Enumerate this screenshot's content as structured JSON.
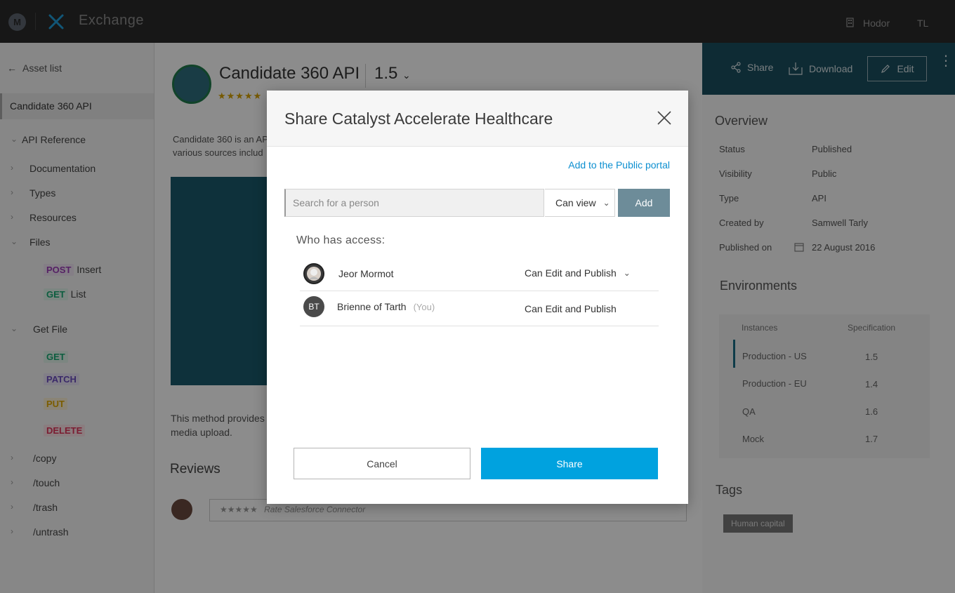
{
  "topbar": {
    "app_title": "Exchange",
    "org_name": "Hodor",
    "user_initials": "TL"
  },
  "sidebar": {
    "back_label": "Asset list",
    "current_asset": "Candidate 360 API",
    "api_reference": "API Reference",
    "items": [
      {
        "label": "Documentation"
      },
      {
        "label": "Types"
      },
      {
        "label": "Resources"
      },
      {
        "label": "Files"
      }
    ],
    "files_methods": [
      {
        "method": "POST",
        "label": "Insert"
      },
      {
        "method": "GET",
        "label": "List"
      }
    ],
    "get_file": "Get File",
    "get_file_methods": [
      "GET",
      "PATCH",
      "PUT",
      "DELETE"
    ],
    "resources": [
      "/copy",
      "/touch",
      "/trash",
      "/untrash"
    ]
  },
  "main": {
    "asset_title": "Candidate 360 API",
    "version": "1.5",
    "stars": "★★★★★",
    "desc_line1": "Candidate 360 is an AP",
    "desc_line2": "various sources includ",
    "method_desc_line1": "This method provides",
    "method_desc_line2": "media upload.",
    "reviews_title": "Reviews",
    "review_stars": "★★★★★",
    "review_placeholder": "Rate Salesforce Connector"
  },
  "rightpanel": {
    "share_label": "Share",
    "download_label": "Download",
    "edit_label": "Edit",
    "overview_title": "Overview",
    "overview": [
      {
        "label": "Status",
        "value": "Published"
      },
      {
        "label": "Visibility",
        "value": "Public"
      },
      {
        "label": "Type",
        "value": "API"
      },
      {
        "label": "Created by",
        "value": "Samwell Tarly"
      },
      {
        "label": "Published on",
        "value": "22 August 2016"
      }
    ],
    "environments_title": "Environments",
    "env_headers": {
      "instances": "Instances",
      "specification": "Specification"
    },
    "environments": [
      {
        "name": "Production - US",
        "spec": "1.5"
      },
      {
        "name": "Production - EU",
        "spec": "1.4"
      },
      {
        "name": "QA",
        "spec": "1.6"
      },
      {
        "name": "Mock",
        "spec": "1.7"
      }
    ],
    "tags_title": "Tags",
    "tag": "Human capital"
  },
  "modal": {
    "title": "Share Catalyst Accelerate Healthcare",
    "public_link": "Add to the Public portal",
    "search_placeholder": "Search for a person",
    "permission_selected": "Can view",
    "add_label": "Add",
    "access_label": "Who has access:",
    "people": [
      {
        "name": "Jeor Mormot",
        "you": "",
        "permission": "Can Edit and Publish"
      },
      {
        "name": "Brienne of Tarth",
        "initials": "BT",
        "you": "(You)",
        "permission": "Can Edit and Publish"
      }
    ],
    "cancel_label": "Cancel",
    "share_label": "Share"
  }
}
